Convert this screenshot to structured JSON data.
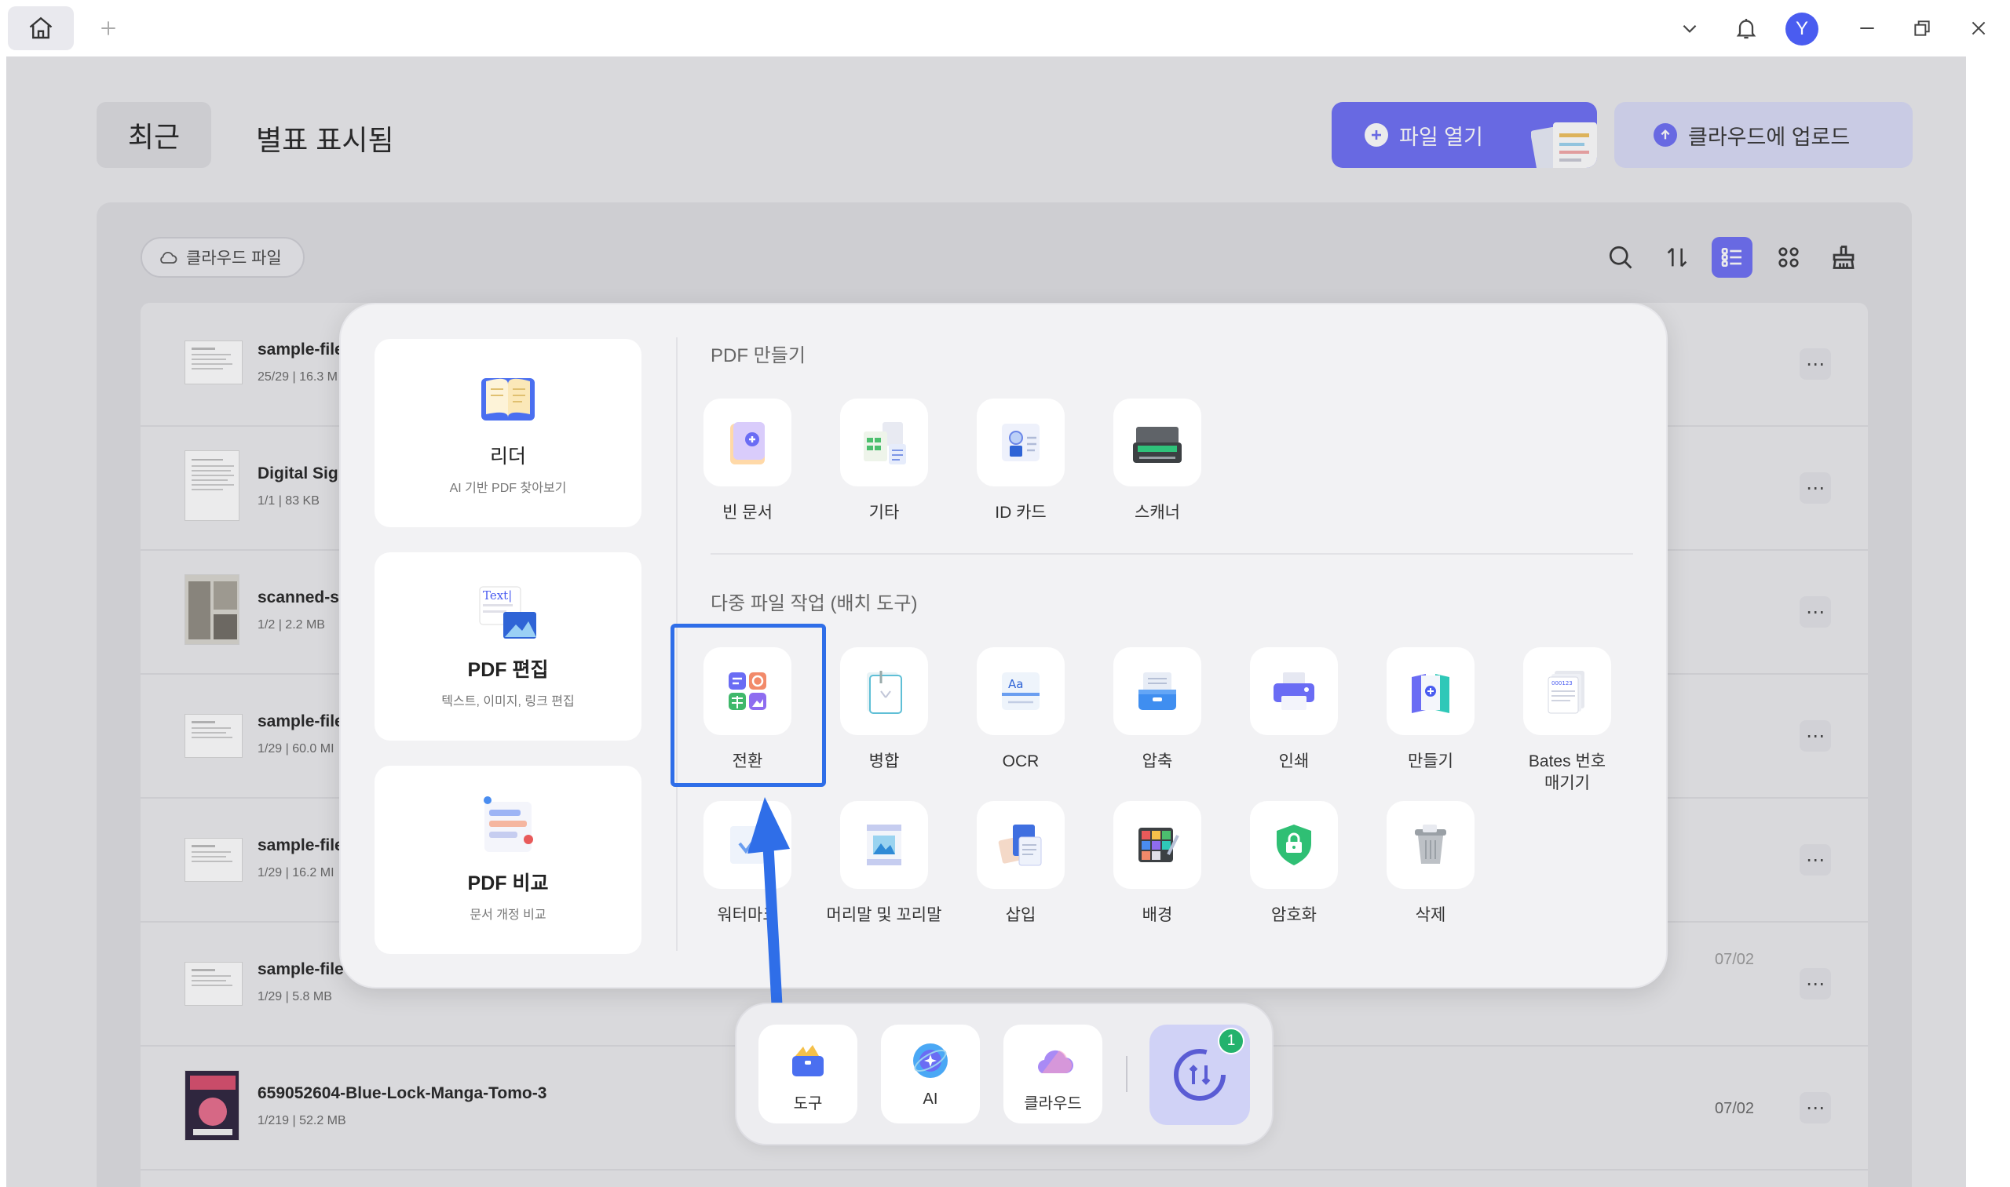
{
  "titlebar": {
    "avatar_letter": "Y"
  },
  "header": {
    "tab_recent": "최근",
    "tab_starred": "별표 표시됨",
    "open_file": "파일 열기",
    "upload_cloud": "클라우드에 업로드"
  },
  "toolbar": {
    "cloud_files": "클라우드 파일"
  },
  "files": [
    {
      "name": "sample-file",
      "meta": "25/29 | 16.3 M",
      "date": ""
    },
    {
      "name": "Digital Sigr",
      "meta": "1/1 | 83 KB",
      "date": ""
    },
    {
      "name": "scanned-sa",
      "meta": "1/2 | 2.2 MB",
      "date": ""
    },
    {
      "name": "sample-file",
      "meta": "1/29 | 60.0 MI",
      "date": ""
    },
    {
      "name": "sample-file",
      "meta": "1/29 | 16.2 MI",
      "date": ""
    },
    {
      "name": "sample-file-",
      "meta": "1/29 | 5.8 MB",
      "date": "07/02"
    },
    {
      "name": "659052604-Blue-Lock-Manga-Tomo-3",
      "meta": "1/219 | 52.2 MB",
      "date": "07/02"
    }
  ],
  "popup": {
    "cards": [
      {
        "title": "리더",
        "subtitle": "AI 기반 PDF 찾아보기"
      },
      {
        "title": "PDF 편집",
        "subtitle": "텍스트, 이미지, 링크 편집",
        "icon_text": "Text|"
      },
      {
        "title": "PDF 비교",
        "subtitle": "문서 개정 비교"
      }
    ],
    "create_title": "PDF 만들기",
    "create_tools": [
      "빈 문서",
      "기타",
      "ID 카드",
      "스캐너"
    ],
    "batch_title": "다중 파일 작업 (배치 도구)",
    "batch_tools_row1": [
      "전환",
      "병합",
      "OCR",
      "압축",
      "인쇄",
      "만들기",
      "Bates 번호\n매기기"
    ],
    "batch_tools_row2": [
      "워터마크",
      "머리말 및 꼬리말",
      "삽입",
      "배경",
      "암호화",
      "삭제"
    ],
    "ocr_icon_text": "Aa",
    "bates_icon_text": "000123"
  },
  "dock": {
    "tools": "도구",
    "ai": "AI",
    "cloud": "클라우드",
    "batch_badge": "1"
  },
  "colors": {
    "accent": "#6a6cf4",
    "highlight": "#2f6ee8",
    "badge": "#23b26d"
  }
}
